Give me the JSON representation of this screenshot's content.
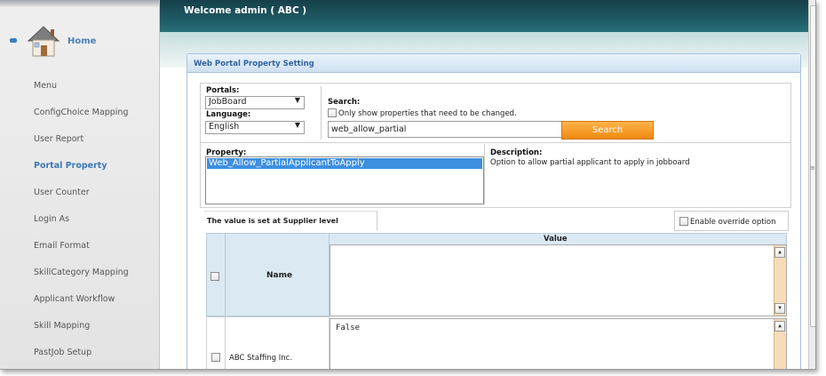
{
  "header": {
    "welcome": "Welcome admin ( ABC )"
  },
  "sidebar": {
    "home_label": "Home",
    "items": [
      {
        "label": "Menu",
        "active": false
      },
      {
        "label": "ConfigChoice Mapping",
        "active": false
      },
      {
        "label": "User Report",
        "active": false
      },
      {
        "label": "Portal Property",
        "active": true
      },
      {
        "label": "User Counter",
        "active": false
      },
      {
        "label": "Login As",
        "active": false
      },
      {
        "label": "Email Format",
        "active": false
      },
      {
        "label": "SkillCategory Mapping",
        "active": false
      },
      {
        "label": "Applicant Workflow",
        "active": false
      },
      {
        "label": "Skill Mapping",
        "active": false
      },
      {
        "label": "PastJob Setup",
        "active": false
      }
    ]
  },
  "panel": {
    "title": "Web Portal Property Setting",
    "portals_label": "Portals:",
    "portals_value": "JobBoard",
    "language_label": "Language:",
    "language_value": "English",
    "search_label": "Search:",
    "only_show_label": "Only show properties that need to be changed.",
    "search_value": "web_allow_partial",
    "search_button": "Search",
    "property_label": "Property:",
    "property_selected": "Web_Allow_PartialApplicantToApply",
    "description_label": "Description:",
    "description_text": "Option to allow partial applicant to apply in jobboard",
    "supplier_level": "The value is set at Supplier level",
    "override_label": "Enable override option"
  },
  "grid": {
    "col_name": "Name",
    "col_value": "Value",
    "row1_name": "ABC Staffing Inc.",
    "row1_value": "False"
  },
  "colors": {
    "header": "#1f5a64",
    "accent": "#3b77b8",
    "search_button": "#f39419",
    "selection": "#3d8fe0"
  }
}
